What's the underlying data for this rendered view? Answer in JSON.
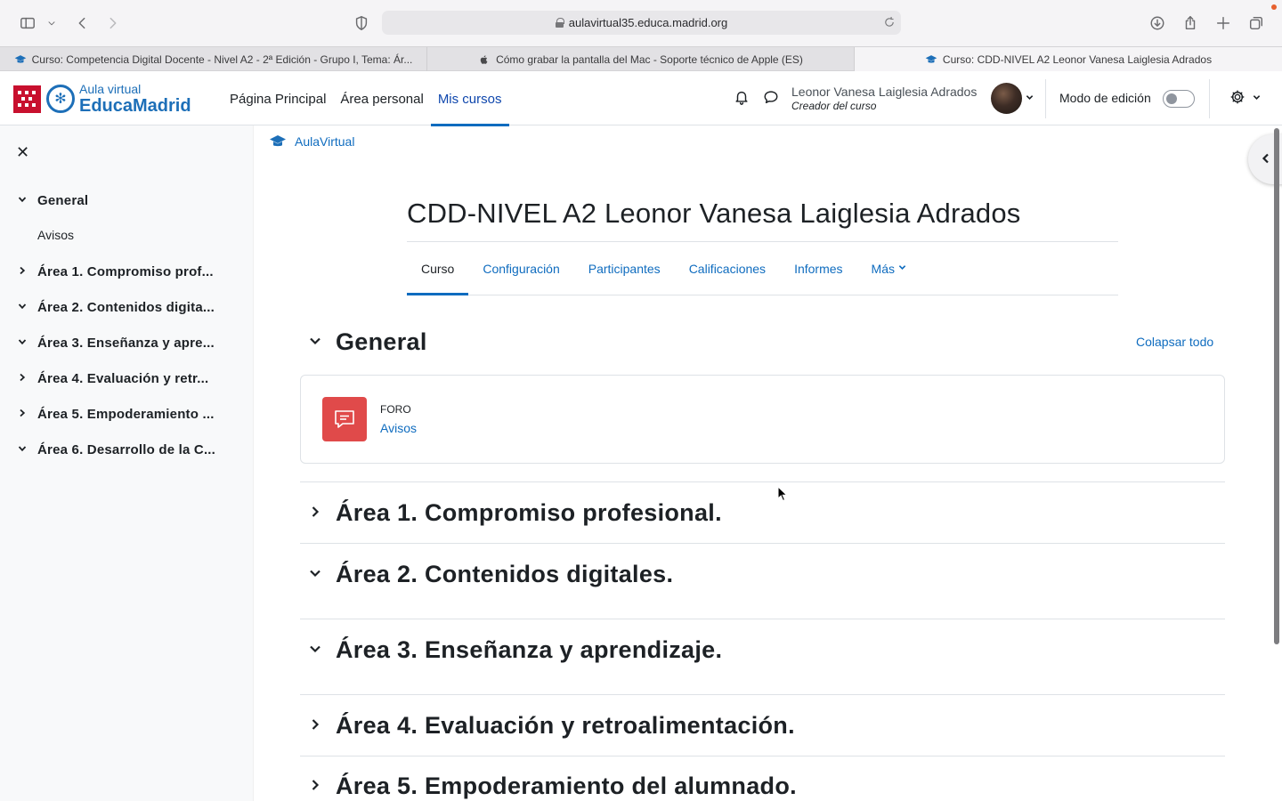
{
  "browser": {
    "url": "aulavirtual35.educa.madrid.org",
    "tabs": [
      {
        "label": "Curso: Competencia Digital Docente - Nivel A2 - 2ª Edición - Grupo I, Tema: Ár...",
        "icon": "graduation-cap-icon"
      },
      {
        "label": "Cómo grabar la pantalla del Mac - Soporte técnico de Apple (ES)",
        "icon": "apple-icon"
      },
      {
        "label": "Curso: CDD-NIVEL A2 Leonor Vanesa Laiglesia Adrados",
        "icon": "graduation-cap-icon",
        "active": true
      }
    ]
  },
  "header": {
    "logo_sub": "Aula virtual",
    "logo_main": "EducaMadrid",
    "nav": [
      "Página Principal",
      "Área personal",
      "Mis cursos"
    ],
    "active_nav": "Mis cursos",
    "user_name": "Leonor Vanesa Laiglesia Adrados",
    "user_role": "Creador del curso",
    "edit_mode_label": "Modo de edición",
    "edit_mode_on": false
  },
  "drawer": {
    "items": [
      {
        "label": "General",
        "expanded": true
      },
      {
        "label": "Área 1. Compromiso prof...",
        "expanded": false
      },
      {
        "label": "Área 2. Contenidos digita...",
        "expanded": true
      },
      {
        "label": "Área 3. Enseñanza y apre...",
        "expanded": true
      },
      {
        "label": "Área 4. Evaluación y retr...",
        "expanded": false
      },
      {
        "label": "Área 5. Empoderamiento ...",
        "expanded": false
      },
      {
        "label": "Área 6. Desarrollo de la C...",
        "expanded": true
      }
    ],
    "sub_item": "Avisos"
  },
  "main": {
    "breadcrumb": "AulaVirtual",
    "title": "CDD-NIVEL A2 Leonor Vanesa Laiglesia Adrados",
    "course_nav": [
      "Curso",
      "Configuración",
      "Participantes",
      "Calificaciones",
      "Informes",
      "Más"
    ],
    "active_course_nav": "Curso",
    "collapse_all": "Colapsar todo",
    "activity": {
      "type": "FORO",
      "name": "Avisos"
    },
    "sections": [
      {
        "title": "General",
        "expanded": true
      },
      {
        "title": "Área 1. Compromiso profesional.",
        "expanded": false
      },
      {
        "title": "Área 2. Contenidos digitales.",
        "expanded": true
      },
      {
        "title": "Área 3. Enseñanza y aprendizaje.",
        "expanded": true
      },
      {
        "title": "Área 4. Evaluación y retroalimentación.",
        "expanded": false
      },
      {
        "title": "Área 5. Empoderamiento del alumnado.",
        "expanded": false
      }
    ]
  },
  "colors": {
    "link": "#0f6cbf",
    "brand": "#1d6fb8",
    "flag_red": "#c8102e",
    "forum_icon_bg": "#e04a4a"
  }
}
